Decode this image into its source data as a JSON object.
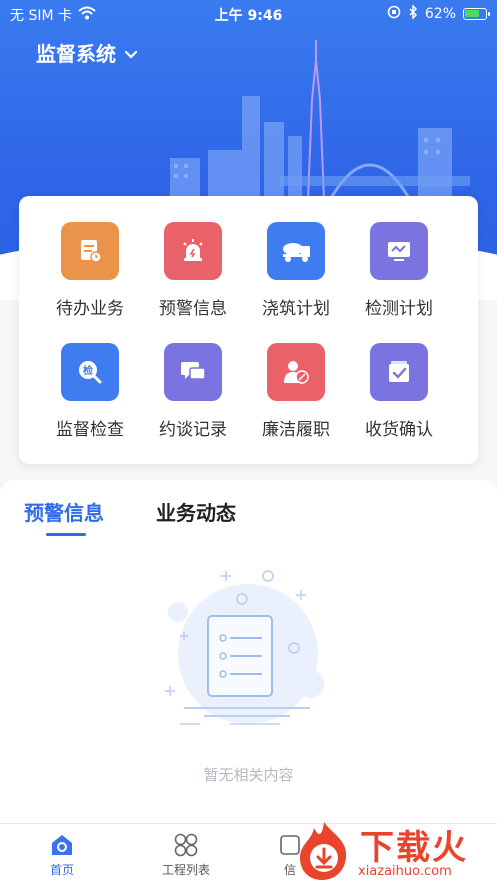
{
  "status_bar": {
    "carrier": "无 SIM 卡",
    "time": "上午 9:46",
    "battery": "62%"
  },
  "header": {
    "title": "监督系统"
  },
  "grid": [
    {
      "label": "待办业务",
      "icon": "todo-icon",
      "color": "#e9944a"
    },
    {
      "label": "预警信息",
      "icon": "alarm-icon",
      "color": "#e9626a"
    },
    {
      "label": "浇筑计划",
      "icon": "mixer-truck-icon",
      "color": "#3f7cf0"
    },
    {
      "label": "检测计划",
      "icon": "monitor-icon",
      "color": "#7b73e0"
    },
    {
      "label": "监督检查",
      "icon": "inspect-icon",
      "color": "#3f7cf0"
    },
    {
      "label": "约谈记录",
      "icon": "chat-icon",
      "color": "#7b73e0"
    },
    {
      "label": "廉洁履职",
      "icon": "party-icon",
      "color": "#e9626a"
    },
    {
      "label": "收货确认",
      "icon": "box-check-icon",
      "color": "#7b73e0"
    }
  ],
  "tabs": [
    {
      "label": "预警信息",
      "active": true
    },
    {
      "label": "业务动态",
      "active": false
    }
  ],
  "empty_state": {
    "text": "暂无相关内容"
  },
  "tabbar": [
    {
      "label": "首页",
      "icon": "home-icon",
      "active": true
    },
    {
      "label": "工程列表",
      "icon": "grid-icon",
      "active": false
    },
    {
      "label": "信",
      "icon": "info-icon",
      "active": false
    }
  ],
  "watermark": {
    "brand": "下载火",
    "domain": "xiazaihuo.com"
  },
  "colors": {
    "primary": "#2f6bea",
    "hero_top": "#3a7bf0",
    "hero_bottom": "#2b5fe0"
  }
}
